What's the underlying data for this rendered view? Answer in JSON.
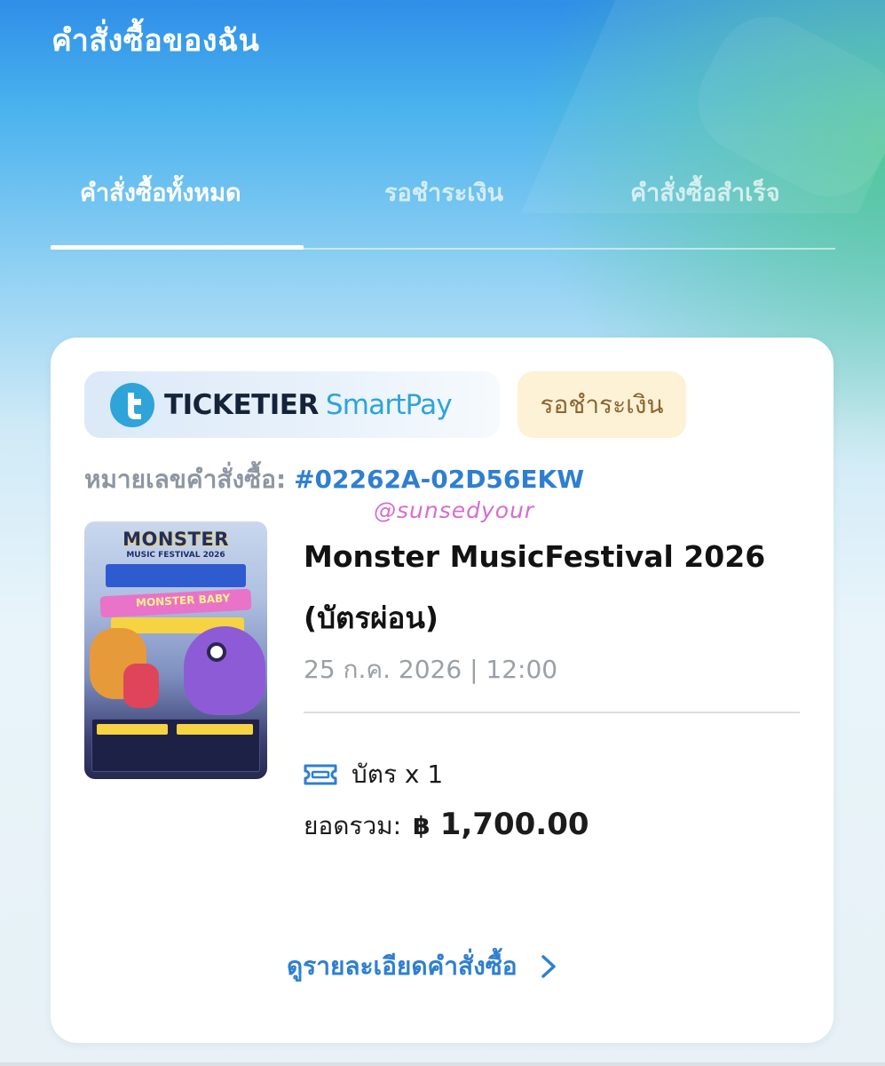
{
  "header": {
    "title": "คำสั่งซื้อของฉัน"
  },
  "tabs": [
    {
      "label": "คำสั่งซื้อทั้งหมด",
      "active": true
    },
    {
      "label": "รอชำระเงิน",
      "active": false
    },
    {
      "label": "คำสั่งซื้อสำเร็จ",
      "active": false
    }
  ],
  "order": {
    "brand": {
      "name": "TICKETIER",
      "sub": "SmartPay"
    },
    "status": "รอชำระเงิน",
    "order_number_label": "หมายเลขคำสั่งซื้อ:",
    "order_number": "#02262A-02D56EKW",
    "watermark": "@sunsedyour",
    "poster": {
      "title": "MONSTER",
      "subtitle": "MUSIC FESTIVAL 2026",
      "banner": "MONSTER BABY"
    },
    "event_title": "Monster MusicFestival 2026 (บัตรผ่อน)",
    "event_datetime": "25 ก.ค. 2026 | 12:00",
    "tickets": "บัตร x 1",
    "total_label": "ยอดรวม:",
    "total_currency": "฿",
    "total_amount": "1,700.00",
    "details_link": "ดูรายละเอียดคำสั่งซื้อ"
  },
  "colors": {
    "accent": "#2f7fd0",
    "status_bg": "#fdf1d6",
    "status_text": "#8a6530"
  },
  "icons": [
    "ticketier-logo-icon",
    "ticket-icon",
    "chevron-right-icon"
  ]
}
